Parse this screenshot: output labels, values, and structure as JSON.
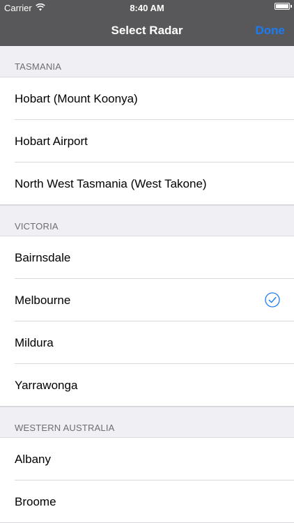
{
  "status_bar": {
    "carrier": "Carrier",
    "time": "8:40 AM",
    "icons": [
      "wifi-icon",
      "battery-icon"
    ]
  },
  "nav": {
    "title": "Select Radar",
    "done_label": "Done"
  },
  "colors": {
    "accent": "#1a7cf0",
    "bar_background": "#58585a",
    "group_background": "#efeff4"
  },
  "sections": [
    {
      "header": "TASMANIA",
      "items": [
        {
          "label": "Hobart (Mount Koonya)",
          "selected": false
        },
        {
          "label": "Hobart Airport",
          "selected": false
        },
        {
          "label": "North West Tasmania (West Takone)",
          "selected": false
        }
      ]
    },
    {
      "header": "VICTORIA",
      "items": [
        {
          "label": "Bairnsdale",
          "selected": false
        },
        {
          "label": "Melbourne",
          "selected": true
        },
        {
          "label": "Mildura",
          "selected": false
        },
        {
          "label": "Yarrawonga",
          "selected": false
        }
      ]
    },
    {
      "header": "WESTERN AUSTRALIA",
      "items": [
        {
          "label": "Albany",
          "selected": false
        },
        {
          "label": "Broome",
          "selected": false
        }
      ]
    }
  ]
}
